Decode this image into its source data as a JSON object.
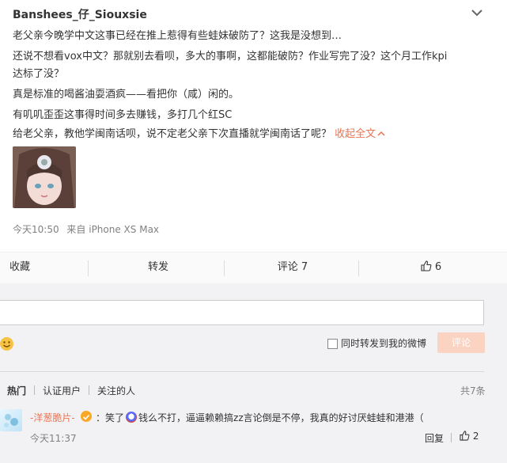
{
  "post": {
    "username": "Banshees_仔_Siouxsie",
    "lines": [
      "老父亲今晚学中文这事已经在推上惹得有些蛙妹破防了？这我是没想到…",
      "还说不想看vox中文？那就别去看呗，多大的事啊，这都能破防？作业写完了没？这个月工作kpi",
      "达标了没？",
      "真是标准的喝酱油耍酒疯——看把你（咸）闲的。",
      "有叽叽歪歪这事得时间多去赚钱，多打几个红SC",
      "给老父亲，教他学闽南话呗，说不定老父亲下次直播就学闽南话了呢？"
    ],
    "collapse_label": "收起全文",
    "time": "今天10:50",
    "source": "来自 iPhone XS Max"
  },
  "actions": {
    "favorite": "收藏",
    "repost": "转发",
    "comment": "评论 7",
    "like_count": "6"
  },
  "comment_box": {
    "forward_label": "同时转发到我的微博",
    "submit_label": "评论"
  },
  "comment_tabs": {
    "hot": "热门",
    "verified": "认证用户",
    "following": "关注的人",
    "total": "共7条"
  },
  "comments": [
    {
      "user": "-洋葱脆片-",
      "text_before": "：笑了",
      "text_after": "钱么不打，逼逼赖赖搞zz言论倒是不停，我真的好讨厌蛙蛙和港港（",
      "time": "今天11:37",
      "reply_label": "回复",
      "like_count": "2"
    }
  ],
  "colors": {
    "accent": "#eb7350",
    "panel_bg": "#f2f2f5",
    "submit_bg": "#fbd3c2"
  }
}
